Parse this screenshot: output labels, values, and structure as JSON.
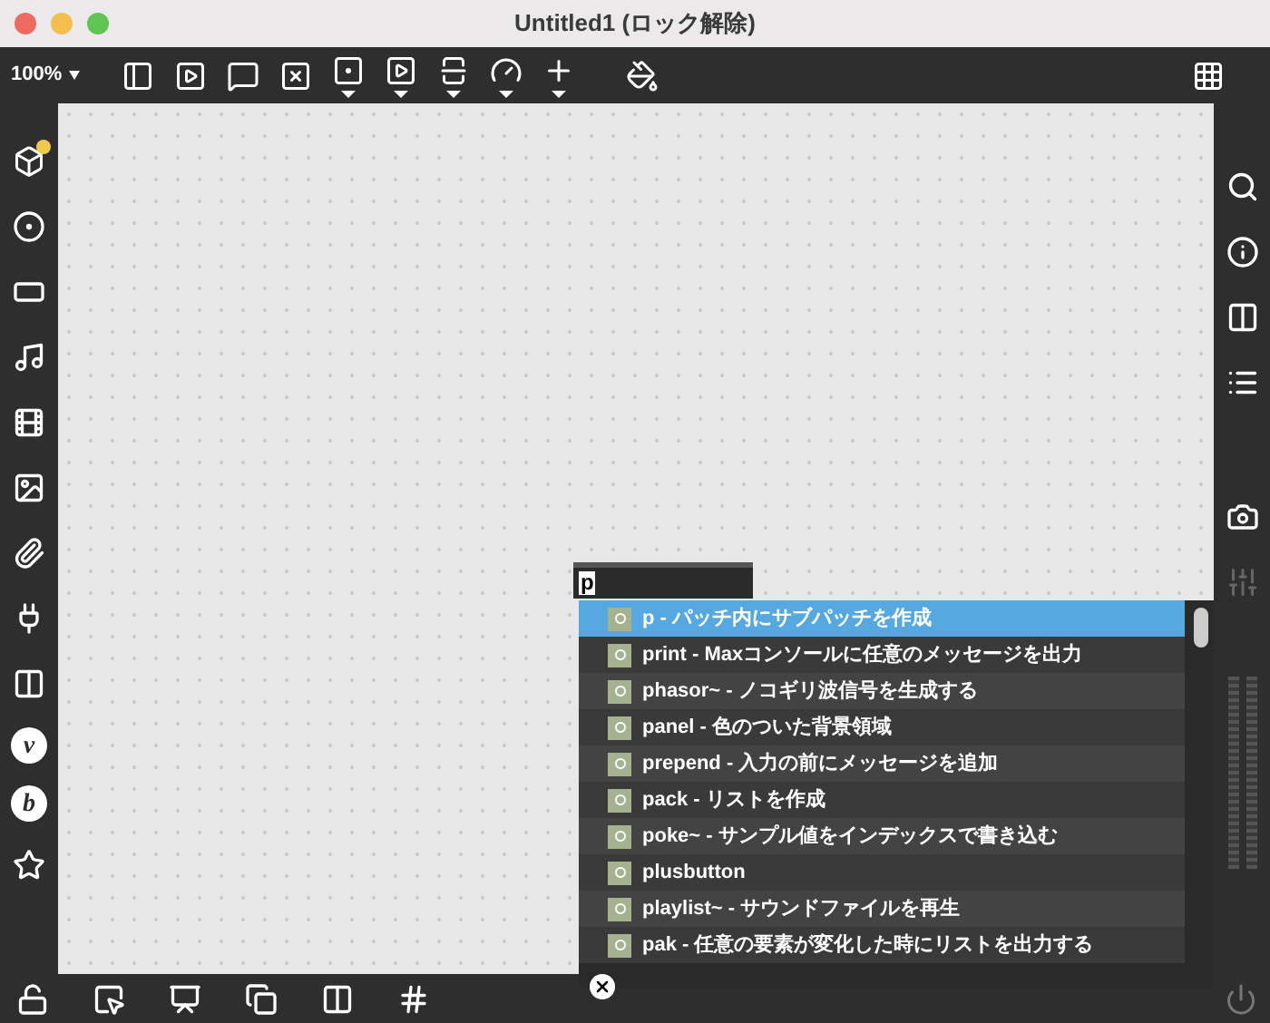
{
  "window": {
    "title": "Untitled1 (ロック解除)"
  },
  "toolbar": {
    "zoom": "100%"
  },
  "sidebar": {
    "badges": [
      "v",
      "b"
    ]
  },
  "object_box": {
    "value": "p"
  },
  "autocomplete": {
    "items": [
      {
        "text": "p - パッチ内にサブパッチを作成",
        "selected": true
      },
      {
        "text": "print - Maxコンソールに任意のメッセージを出力",
        "selected": false
      },
      {
        "text": "phasor~ - ノコギリ波信号を生成する",
        "selected": false
      },
      {
        "text": "panel - 色のついた背景領域",
        "selected": false
      },
      {
        "text": "prepend - 入力の前にメッセージを追加",
        "selected": false
      },
      {
        "text": "pack - リストを作成",
        "selected": false
      },
      {
        "text": "poke~ - サンプル値をインデックスで書き込む",
        "selected": false
      },
      {
        "text": "plusbutton",
        "selected": false
      },
      {
        "text": "playlist~ - サウンドファイルを再生",
        "selected": false
      },
      {
        "text": "pak - 任意の要素が変化した時にリストを出力する",
        "selected": false
      }
    ]
  }
}
